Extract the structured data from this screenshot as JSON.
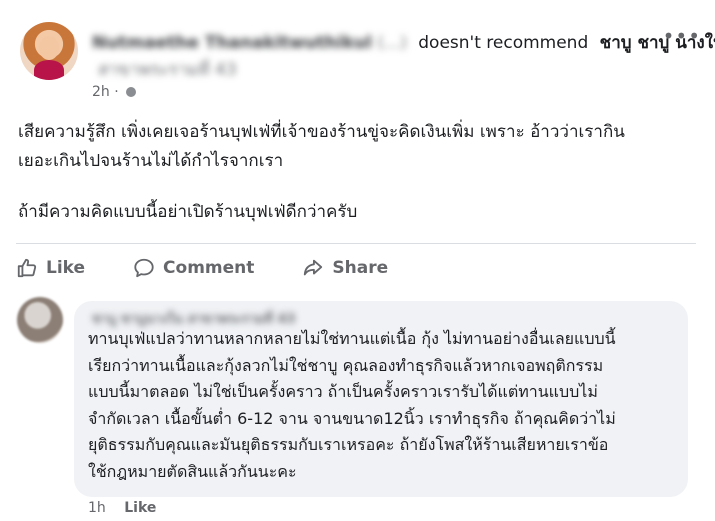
{
  "post": {
    "author_name": "Nutmaethe Thanakitwuthikul",
    "author_suffix": "(...)",
    "action_text": "doesn't recommend",
    "page_name": "ชาบู ชาบู นางใน",
    "page_branch": "สาขาพระรามที่ 43",
    "timestamp": "2h",
    "body_lines": [
      "เสียความรู้สึก เพิ่งเคยเจอร้านบุฟเฟ่ที่เจ้าของร้านขู่จะคิดเงินเพิ่ม เพราะ อ้าวว่าเรากิน",
      "เยอะเกินไปจนร้านไม่ได้กำไรจากเรา",
      "ถ้ามีความคิดแบบนี้อย่าเปิดร้านบุฟเฟ่ดีกว่าครับ"
    ]
  },
  "actions": {
    "like": "Like",
    "comment": "Comment",
    "share": "Share"
  },
  "comment": {
    "author": "ชาบู ชาบูนางใน สาขาพระรามที่ 43",
    "lines": [
      "ทานบุเฟ่แปลว่าทานหลากหลายไม่ใช่ทานแต่เนื้อ กุ้ง ไม่ทานอย่างอื่นเลยแบบนี้",
      "เรียกว่าทานเนื้อและกุ้งลวกไม่ใช่ชาบู คุณลองทำธุรกิจแล้วหากเจอพฤติกรรม",
      "แบบนี้มาตลอด ไม่ใช่เป็นครั้งคราว ถ้าเป็นครั้งคราวเรารับได้แต่ทานแบบไม่",
      "จำกัดเวลา เนื้อขั้นต่ำ 6-12 จาน จานขนาด12นิ้ว เราทำธุรกิจ ถ้าคุณคิดว่าไม่",
      "ยุติธรรมกับคุณและมันยุติธรรมกับเราเหรอคะ ถ้ายังโพสให้ร้านเสียหายเราข้อ",
      "ใช้กฎหมายตัดสินแล้วกันนะคะ"
    ],
    "timestamp": "1h",
    "like_label": "Like"
  },
  "icons": {
    "more": "more-horizontal-icon",
    "privacy": "globe-icon",
    "like": "thumbs-up-icon",
    "comment": "comment-bubble-icon",
    "share": "share-arrow-icon"
  },
  "colors": {
    "text": "#1c1e21",
    "secondary": "#65676b",
    "bubble": "#f0f2f5",
    "divider": "#dadde1"
  }
}
